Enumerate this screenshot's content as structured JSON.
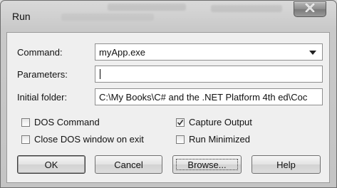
{
  "window": {
    "title": "Run"
  },
  "form": {
    "command_label": "Command:",
    "command_value": "myApp.exe",
    "parameters_label": "Parameters:",
    "parameters_value": "",
    "folder_label": "Initial folder:",
    "folder_value": "C:\\My Books\\C# and the .NET Platform 4th ed\\Coc"
  },
  "options": {
    "dos_command": {
      "label": "DOS Command",
      "checked": false
    },
    "capture_output": {
      "label": "Capture Output",
      "checked": true
    },
    "close_dos": {
      "label": "Close DOS window on exit",
      "checked": false
    },
    "run_minimized": {
      "label": "Run Minimized",
      "checked": false
    }
  },
  "buttons": {
    "ok": "OK",
    "cancel": "Cancel",
    "browse": "Browse...",
    "help": "Help"
  },
  "icons": {
    "close": "close-icon",
    "dropdown": "chevron-down-icon",
    "check": "checkmark-icon"
  }
}
